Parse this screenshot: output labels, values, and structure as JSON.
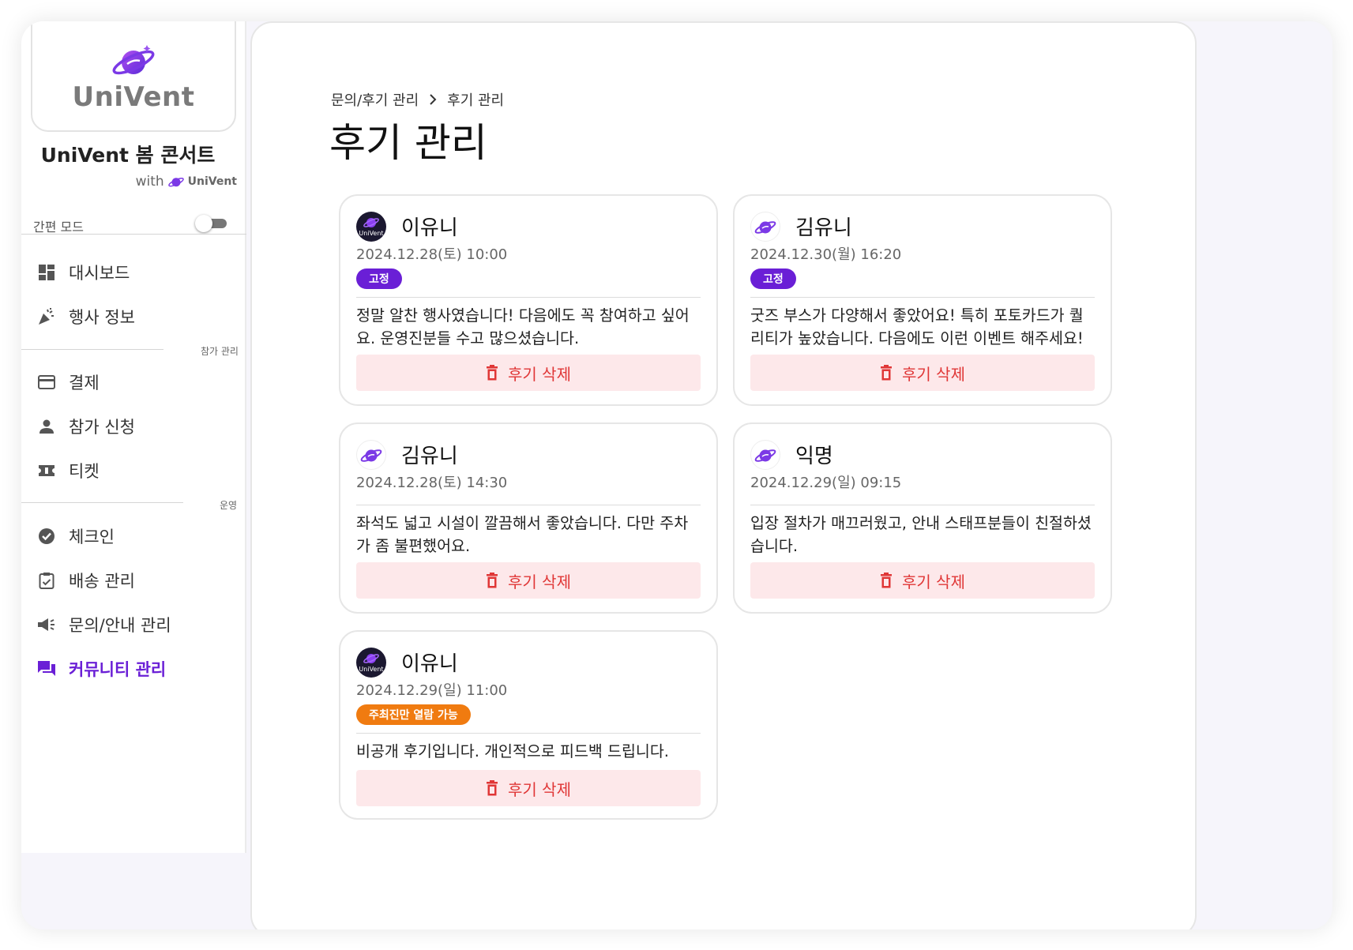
{
  "sidebar": {
    "logo_text": "UniVent",
    "event_title": "UniVent 봄 콘서트",
    "with_label": "with",
    "with_brand": "UniVent",
    "simple_mode_label": "간편 모드",
    "simple_mode_on": false,
    "nav_group1": [
      {
        "label": "대시보드",
        "icon": "dashboard-icon"
      },
      {
        "label": "행사 정보",
        "icon": "party-popper-icon"
      }
    ],
    "section_participation": "참가 관리",
    "nav_group2": [
      {
        "label": "결제",
        "icon": "credit-card-icon"
      },
      {
        "label": "참가 신청",
        "icon": "person-icon"
      },
      {
        "label": "티켓",
        "icon": "ticket-icon"
      }
    ],
    "section_operation": "운영",
    "nav_group3": [
      {
        "label": "체크인",
        "icon": "check-circle-icon"
      },
      {
        "label": "배송 관리",
        "icon": "clipboard-check-icon"
      },
      {
        "label": "문의/안내 관리",
        "icon": "megaphone-icon"
      },
      {
        "label": "커뮤니티 관리",
        "icon": "chat-icon",
        "active": true
      }
    ]
  },
  "breadcrumb": {
    "parent": "문의/후기 관리",
    "current": "후기 관리"
  },
  "page_title": "후기 관리",
  "colors": {
    "accent": "#6a1fd6",
    "badge_pinned": "#6a1fd6",
    "badge_private": "#f07b10",
    "delete_bg": "#fde8ea",
    "delete_text": "#e03636"
  },
  "reviews": [
    {
      "author": "이유니",
      "avatar": "dark-logo-avatar",
      "date": "2024.12.28(토) 10:00",
      "badge": "고정",
      "badge_type": "pinned",
      "content": "정말 알찬 행사였습니다! 다음에도 꼭 참여하고 싶어요. 운영진분들 수고 많으셨습니다.",
      "delete_label": "후기 삭제"
    },
    {
      "author": "김유니",
      "avatar": "planet-avatar",
      "date": "2024.12.30(월) 16:20",
      "badge": "고정",
      "badge_type": "pinned",
      "content": "굿즈 부스가 다양해서 좋았어요! 특히 포토카드가 퀄리티가 높았습니다. 다음에도 이런 이벤트 해주세요!",
      "delete_label": "후기 삭제"
    },
    {
      "author": "김유니",
      "avatar": "planet-avatar",
      "date": "2024.12.28(토) 14:30",
      "badge": "",
      "badge_type": "",
      "content": "좌석도 넓고 시설이 깔끔해서 좋았습니다. 다만 주차가 좀 불편했어요.",
      "delete_label": "후기 삭제"
    },
    {
      "author": "익명",
      "avatar": "planet-avatar",
      "date": "2024.12.29(일) 09:15",
      "badge": "",
      "badge_type": "",
      "content": "입장 절차가 매끄러웠고, 안내 스태프분들이 친절하셨습니다.",
      "delete_label": "후기 삭제"
    },
    {
      "author": "이유니",
      "avatar": "dark-logo-avatar",
      "date": "2024.12.29(일) 11:00",
      "badge": "주최진만 열람 가능",
      "badge_type": "private",
      "content": "비공개 후기입니다. 개인적으로 피드백 드립니다.",
      "delete_label": "후기 삭제"
    }
  ]
}
